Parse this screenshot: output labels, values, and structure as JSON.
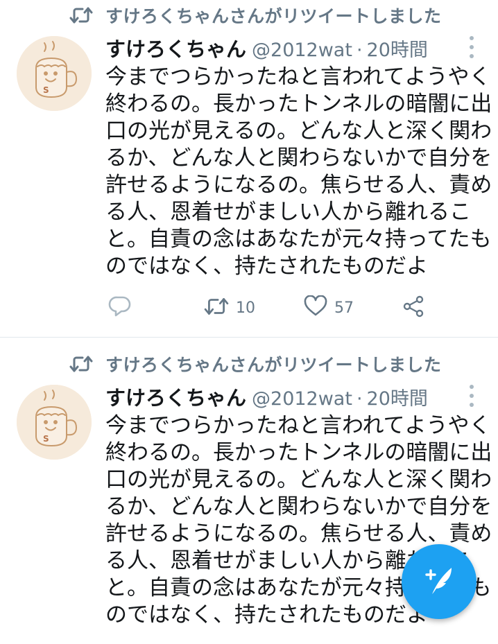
{
  "tweets": [
    {
      "retweet_label": "すけろくちゃんさんがリツイートしました",
      "author_name": "すけろくちゃん",
      "handle": "@2012wat",
      "separator": "·",
      "time": "20時間",
      "text_lines": [
        "今までつらかったねと言われてようやく",
        "終わるの。長かったトンネルの暗闇に出",
        "口の光が見えるの。どんな人と深く関わ",
        "るか、どんな人と関わらないかで自分を",
        "許せるようになるの。焦らせる人、責め",
        "る人、恩着せがましい人から離れるこ",
        "と。自責の念はあなたが元々持ってたも",
        "のではなく、持たされたものだよ"
      ],
      "retweet_count": "10",
      "like_count": "57"
    },
    {
      "retweet_label": "すけろくちゃんさんがリツイートしました",
      "author_name": "すけろくちゃん",
      "handle": "@2012wat",
      "separator": "·",
      "time": "20時間",
      "text_lines": [
        "今までつらかったねと言われてようやく",
        "終わるの。長かったトンネルの暗闇に出",
        "口の光が見えるの。どんな人と深く関わ",
        "るか、どんな人と関わらないかで自分を",
        "許せるようになるの。焦らせる人、責め",
        "る人、恩着せがましい人から離れるこ",
        "と。自責の念はあなたが元々持ってたも",
        "のではなく、持たされたものだよ"
      ]
    }
  ],
  "icons": {
    "retweet_context": "retweet-icon",
    "reply": "reply-icon",
    "retweet": "retweet-icon",
    "like": "heart-icon",
    "share": "share-icon",
    "more": "more-vertical-icon",
    "compose": "compose-tweet-icon"
  },
  "colors": {
    "accent": "#1da1f2",
    "secondary_text": "#657786",
    "icon": "#657786",
    "divider": "#e1e8ed"
  }
}
